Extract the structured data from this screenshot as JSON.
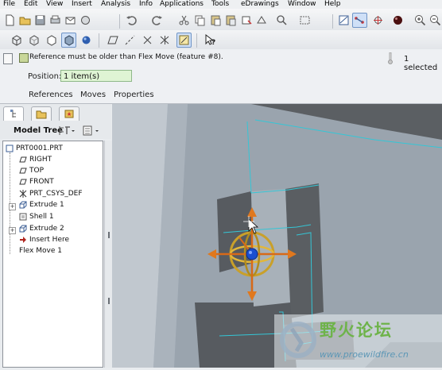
{
  "menu": [
    "File",
    "Edit",
    "View",
    "Insert",
    "Analysis",
    "Info",
    "Applications",
    "Tools",
    "eDrawings",
    "Window",
    "Help"
  ],
  "dashboard": {
    "message": "Reference must be older than Flex Move (feature #8).",
    "position_label": "Position:",
    "position_value": "1 item(s)",
    "tabs": [
      "References",
      "Moves",
      "Properties"
    ],
    "selection_count": "1 selected"
  },
  "model_tree": {
    "label": "Model Tree",
    "nodes": [
      {
        "label": "PRT0001.PRT",
        "icon": "part-icon"
      },
      {
        "label": "RIGHT",
        "icon": "datum-plane-icon"
      },
      {
        "label": "TOP",
        "icon": "datum-plane-icon"
      },
      {
        "label": "FRONT",
        "icon": "datum-plane-icon"
      },
      {
        "label": "PRT_CSYS_DEF",
        "icon": "coordinate-system-icon"
      },
      {
        "label": "Extrude 1",
        "icon": "extrude-icon"
      },
      {
        "label": "Shell 1",
        "icon": "shell-icon"
      },
      {
        "label": "Extrude 2",
        "icon": "extrude-icon"
      },
      {
        "label": "Insert Here",
        "icon": "insert-arrow-icon"
      },
      {
        "label": "Flex Move 1",
        "icon": ""
      }
    ]
  },
  "watermark": {
    "title": "野火论坛",
    "url": "www.proewildfire.cn"
  },
  "colors": {
    "model_face": "#9aa4ae",
    "edge_highlight": "#34c6d6",
    "dragger_ring": "#c9a02a",
    "dragger_arrow": "#d86a18",
    "dragger_center": "#1b4fd0",
    "position_field": "#dff4d4"
  }
}
